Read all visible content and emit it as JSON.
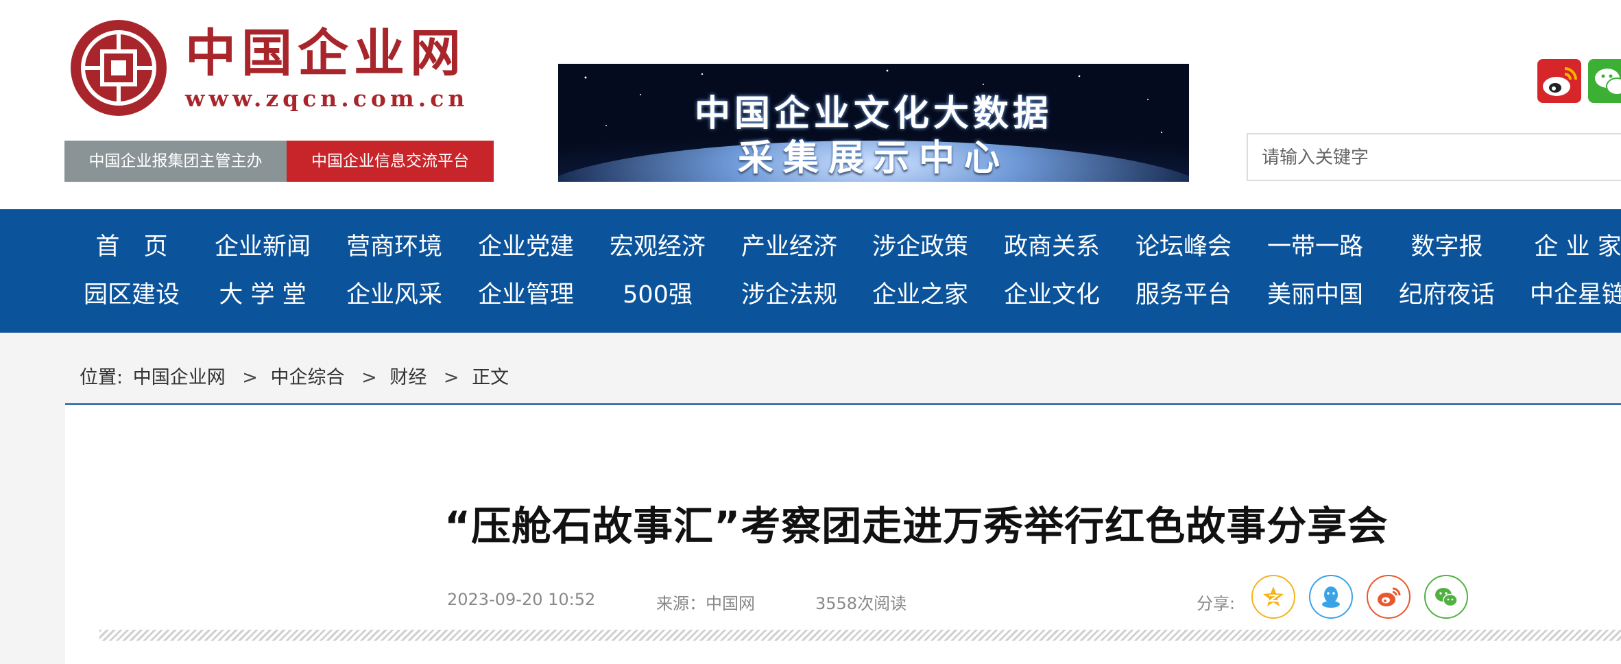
{
  "header": {
    "logo_cn": "中国企业网",
    "logo_url": "www.zqcn.com.cn",
    "tag_sponsor": "中国企业报集团主管主办",
    "tag_platform": "中国企业信息交流平台",
    "banner_line1": "中国企业文化大数据",
    "banner_line2": "采集展示中心",
    "social_icons": [
      "weibo-icon",
      "wechat-icon"
    ],
    "search_placeholder": "请输入关键字"
  },
  "nav": {
    "row1": [
      "首　页",
      "企业新闻",
      "营商环境",
      "企业党建",
      "宏观经济",
      "产业经济",
      "涉企政策",
      "政商关系",
      "论坛峰会",
      "一带一路",
      "数字报",
      "企 业 家"
    ],
    "row2": [
      "园区建设",
      "大 学 堂",
      "企业风采",
      "企业管理",
      "500强",
      "涉企法规",
      "企业之家",
      "企业文化",
      "服务平台",
      "美丽中国",
      "纪府夜话",
      "中企星链"
    ]
  },
  "breadcrumb": {
    "prefix": "位置:",
    "items": [
      "中国企业网",
      "中企综合",
      "财经",
      "正文"
    ],
    "separator": ">"
  },
  "article": {
    "title": "“压舱石故事汇”考察团走进万秀举行红色故事分享会",
    "date": "2023-09-20 10:52",
    "source": "来源：中国网",
    "reads": "3558次阅读",
    "share_label": "分享:",
    "share_icons": [
      "qzone-icon",
      "qq-icon",
      "weibo-icon",
      "wechat-icon"
    ]
  },
  "colors": {
    "brand_red": "#a8262b",
    "nav_blue": "#0b539b",
    "tag_gray": "#8a9396",
    "tag_red": "#c8252a"
  }
}
